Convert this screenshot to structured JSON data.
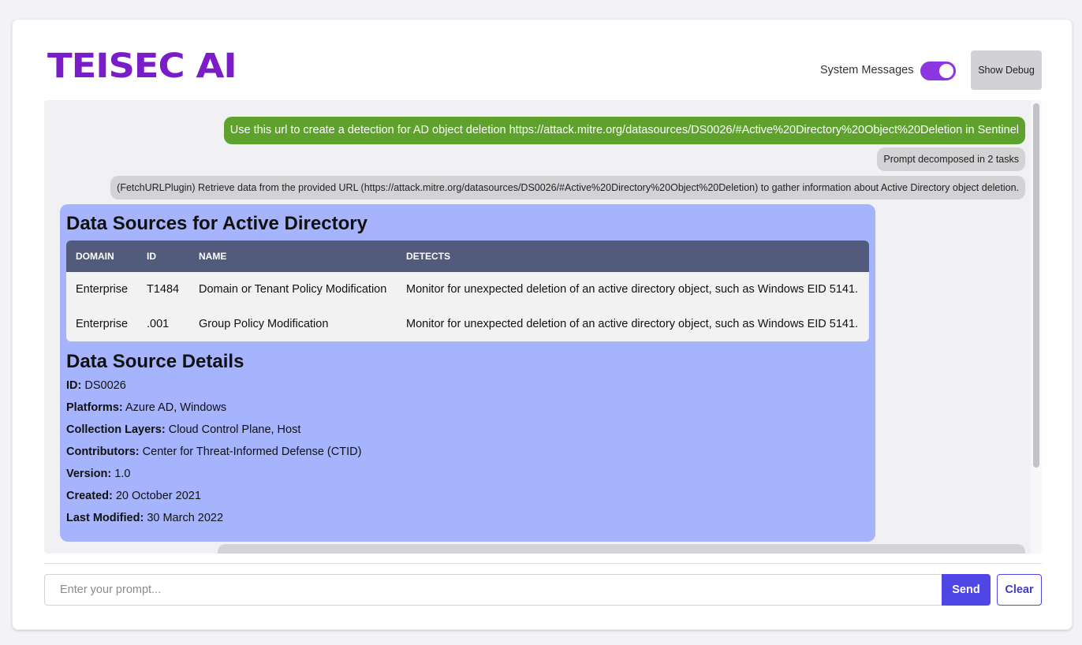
{
  "header": {
    "logo_text": "TEISEC AI",
    "system_messages_label": "System Messages",
    "system_messages_enabled": true,
    "debug_button_label": "Show Debug"
  },
  "chat": {
    "user_message": "Use this url to create a detection for AD object deletion https://attack.mitre.org/datasources/DS0026/#Active%20Directory%20Object%20Deletion in Sentinel",
    "system_message_1": "Prompt decomposed in 2 tasks",
    "system_message_2": "(FetchURLPlugin) Retrieve data from the provided URL (https://attack.mitre.org/datasources/DS0026/#Active%20Directory%20Object%20Deletion) to gather information about Active Directory object deletion.",
    "result": {
      "title": "Data Sources for Active Directory",
      "table": {
        "headers": [
          "DOMAIN",
          "ID",
          "NAME",
          "DETECTS"
        ],
        "rows": [
          [
            "Enterprise",
            "T1484",
            "Domain or Tenant Policy Modification",
            "Monitor for unexpected deletion of an active directory object, such as Windows EID 5141."
          ],
          [
            "Enterprise",
            ".001",
            "Group Policy Modification",
            "Monitor for unexpected deletion of an active directory object, such as Windows EID 5141."
          ]
        ]
      },
      "details_title": "Data Source Details",
      "details": [
        {
          "label": "ID:",
          "value": "DS0026"
        },
        {
          "label": "Platforms:",
          "value": "Azure AD, Windows"
        },
        {
          "label": "Collection Layers:",
          "value": "Cloud Control Plane, Host"
        },
        {
          "label": "Contributors:",
          "value": "Center for Threat-Informed Defense (CTID)"
        },
        {
          "label": "Version:",
          "value": "1.0"
        },
        {
          "label": "Created:",
          "value": "20 October 2021"
        },
        {
          "label": "Last Modified:",
          "value": "30 March 2022"
        }
      ]
    }
  },
  "input": {
    "placeholder": "Enter your prompt...",
    "value": "",
    "send_label": "Send",
    "clear_label": "Clear"
  },
  "colors": {
    "brand": "#7a1cc8",
    "toggle": "#8b36e0",
    "user_bubble": "#5ea22d",
    "result_bubble": "#a5b4fc",
    "table_header": "#525b7c",
    "send_button": "#4f46e5"
  }
}
